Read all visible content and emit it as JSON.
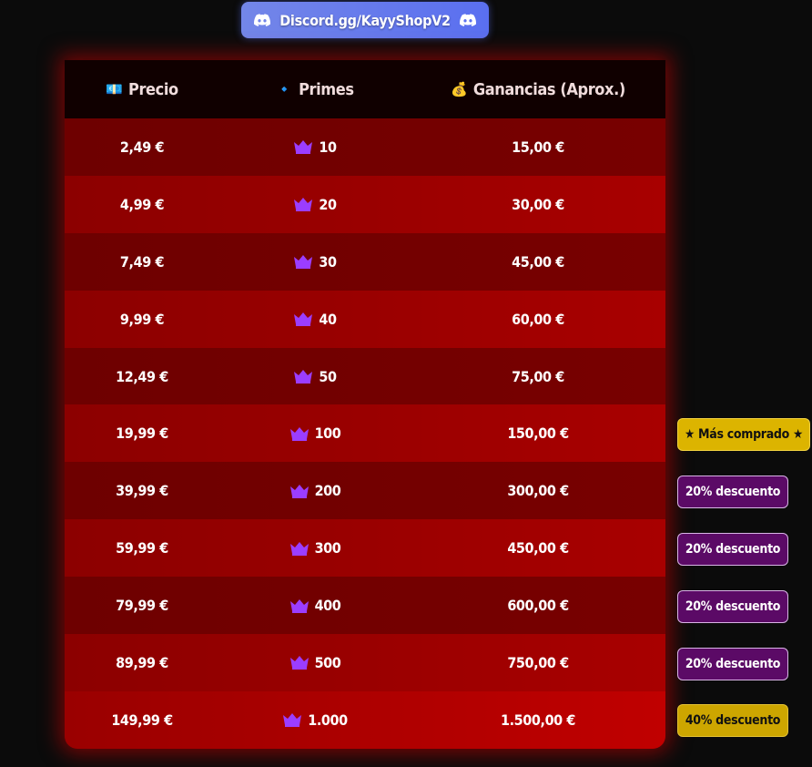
{
  "header": {
    "discord_link": "Discord.gg/KayyShopV2"
  },
  "table": {
    "columns": [
      {
        "icon": "💶",
        "label": "Precio"
      },
      {
        "icon": "🔹",
        "label": "Primes"
      },
      {
        "icon": "💰",
        "label": "Ganancias (Aprox.)"
      }
    ],
    "rows": [
      {
        "price": "2,49 €",
        "primes": "10",
        "earnings": "15,00 €"
      },
      {
        "price": "4,99 €",
        "primes": "20",
        "earnings": "30,00 €"
      },
      {
        "price": "7,49 €",
        "primes": "30",
        "earnings": "45,00 €"
      },
      {
        "price": "9,99 €",
        "primes": "40",
        "earnings": "60,00 €"
      },
      {
        "price": "12,49 €",
        "primes": "50",
        "earnings": "75,00 €"
      },
      {
        "price": "19,99 €",
        "primes": "100",
        "earnings": "150,00 €"
      },
      {
        "price": "39,99 €",
        "primes": "200",
        "earnings": "300,00 €"
      },
      {
        "price": "59,99 €",
        "primes": "300",
        "earnings": "450,00 €"
      },
      {
        "price": "79,99 €",
        "primes": "400",
        "earnings": "600,00 €"
      },
      {
        "price": "89,99 €",
        "primes": "500",
        "earnings": "750,00 €"
      },
      {
        "price": "149,99 €",
        "primes": "1.000",
        "earnings": "1.500,00 €"
      }
    ]
  },
  "badges": [
    {
      "row": 6,
      "label": "★ Más comprado ★",
      "style": "gold"
    },
    {
      "row": 7,
      "label": "20% descuento",
      "style": "purple"
    },
    {
      "row": 8,
      "label": "20% descuento",
      "style": "purple"
    },
    {
      "row": 9,
      "label": "20% descuento",
      "style": "purple"
    },
    {
      "row": 10,
      "label": "20% descuento",
      "style": "purple"
    },
    {
      "row": 11,
      "label": "40% descuento",
      "style": "gold-dark"
    }
  ],
  "colors": {
    "crown": "#9b3dff",
    "discord": "#5865f2",
    "badge_purple": "#5b0a66",
    "badge_gold": "#dcb400"
  }
}
